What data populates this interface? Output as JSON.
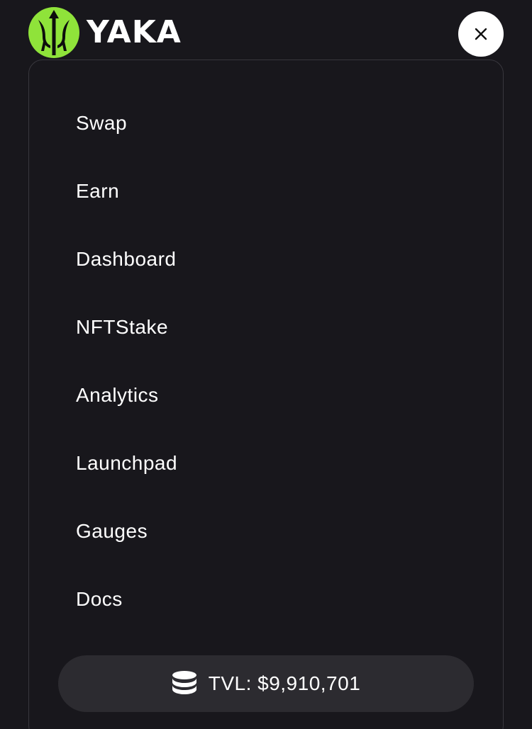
{
  "brand": {
    "name": "YAKA",
    "logo_color": "#8fe33a"
  },
  "header": {
    "close_icon": "close-icon"
  },
  "menu": {
    "items": [
      {
        "label": "Swap"
      },
      {
        "label": "Earn"
      },
      {
        "label": "Dashboard"
      },
      {
        "label": "NFTStake"
      },
      {
        "label": "Analytics"
      },
      {
        "label": "Launchpad"
      },
      {
        "label": "Gauges"
      },
      {
        "label": "Docs"
      }
    ]
  },
  "tvl": {
    "icon": "database-coins-icon",
    "label": "TVL: $9,910,701"
  },
  "colors": {
    "background": "#18171c",
    "panel_border": "#38373d",
    "pill": "#2c2b30",
    "accent": "#8fe33a"
  }
}
